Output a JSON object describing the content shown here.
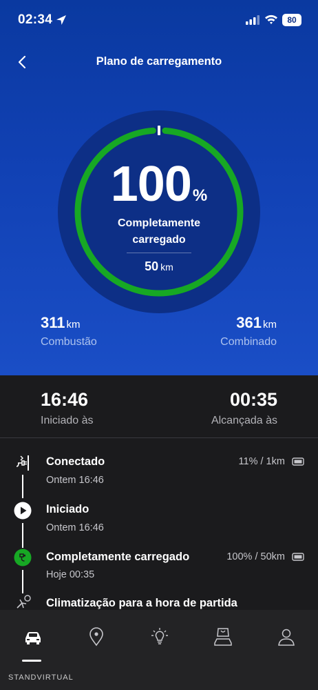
{
  "status_bar": {
    "time": "02:34",
    "battery": "80"
  },
  "header": {
    "title": "Plano de carregamento"
  },
  "gauge": {
    "charge_percent": 100,
    "percent_value": "100",
    "percent_sign": "%",
    "status_line1": "Completamente",
    "status_line2": "carregado",
    "range_value": "50",
    "range_unit": "km",
    "ring_color": "#17a824"
  },
  "ranges": {
    "combustion": {
      "value": "311",
      "unit": "km",
      "label": "Combustão"
    },
    "combined": {
      "value": "361",
      "unit": "km",
      "label": "Combinado"
    }
  },
  "times": {
    "started": {
      "value": "16:46",
      "label": "Iniciado às"
    },
    "reached": {
      "value": "00:35",
      "label": "Alcançada às"
    }
  },
  "timeline": [
    {
      "icon": "plug-icon",
      "title": "Conectado",
      "subtitle": "Ontem 16:46",
      "detail": "11% / 1km"
    },
    {
      "icon": "play-icon",
      "title": "Iniciado",
      "subtitle": "Ontem 16:46",
      "detail": ""
    },
    {
      "icon": "charged-icon",
      "title": "Completamente carregado",
      "subtitle": "Hoje 00:35",
      "detail": "100% / 50km"
    },
    {
      "icon": "climate-icon",
      "title": "Climatização para a hora de partida",
      "subtitle": "",
      "detail": ""
    }
  ],
  "tabs": [
    "car-icon",
    "map-pin-icon",
    "lightbulb-icon",
    "shop-icon",
    "user-icon"
  ],
  "watermark": "STANDVIRTUAL",
  "colors": {
    "hero_blue": "#1141b4",
    "accent_green": "#17a824",
    "dark_bg": "#1b1b1d"
  }
}
